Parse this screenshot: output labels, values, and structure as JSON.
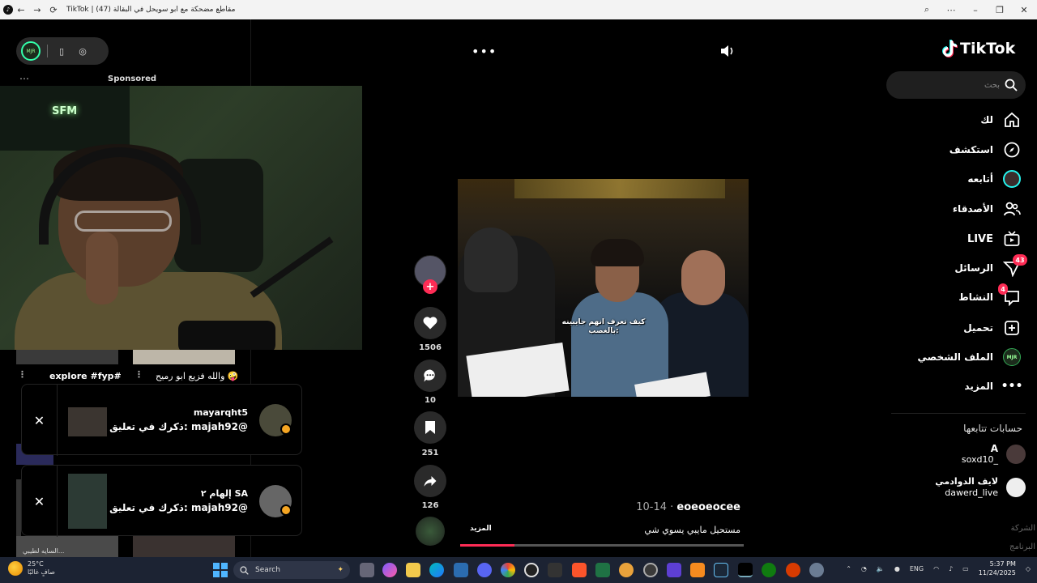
{
  "browser": {
    "tab_title": "TikTok | مقاطع مضحكة مع ابو سويحل في البقالة (47)",
    "back_icon": "arrow-left-icon",
    "reload_icon": "reload-icon",
    "controls": [
      "zoom-icon",
      "more-icon",
      "minimize-icon",
      "restore-icon",
      "close-icon"
    ]
  },
  "left_overlay": {
    "avatar_text": "MJR",
    "sponsored_label": "Sponsored",
    "webcam_logo": "SFM",
    "explore_items": [
      {
        "label": "explore #fyp#"
      },
      {
        "label": "والله فزيع ابو رميح 🤪"
      }
    ],
    "notifications": [
      {
        "name": "mayarqht5",
        "message": "ذكرك في تعليق: majah92@"
      },
      {
        "name": "إلهام ۲ SA",
        "message": "ذكرك في تعليق: majah92@"
      }
    ],
    "bottom_thumb_text": "السايه لطيبي..."
  },
  "video": {
    "caption_line1": "كيف تعرف انهم جايبينه",
    "caption_line2": "بالغصب:",
    "username": "eoeoeocee",
    "date": "10-14",
    "separator": " · ",
    "description": "مستحيل مايبي يسوي شي",
    "more_label": "المزيد",
    "progress_percent": 19
  },
  "actions": {
    "likes": "1506",
    "comments": "10",
    "saves": "251",
    "shares": "126",
    "follow_plus": "+"
  },
  "nav": {
    "logo_text": "TikTok",
    "search_placeholder": "بحث",
    "items": [
      {
        "label": "لك",
        "icon": "home-icon"
      },
      {
        "label": "استكشف",
        "icon": "compass-icon"
      },
      {
        "label": "أتابعه",
        "icon": "following-avatar-icon"
      },
      {
        "label": "الأصدقاء",
        "icon": "friends-icon"
      },
      {
        "label": "LIVE",
        "icon": "live-icon"
      },
      {
        "label": "الرسائل",
        "icon": "messages-icon",
        "badge": "43"
      },
      {
        "label": "النشاط",
        "icon": "activity-icon",
        "badge": "4"
      },
      {
        "label": "تحميل",
        "icon": "upload-icon"
      },
      {
        "label": "الملف الشخصي",
        "icon": "profile-avatar-icon"
      },
      {
        "label": "المزيد",
        "icon": "more-icon"
      }
    ],
    "following_title": "حسابات تتابعها",
    "following_accounts": [
      {
        "display": "A",
        "handle": "soxd10_"
      },
      {
        "display": "لايف الدوادمي",
        "handle": "dawerd_live"
      }
    ],
    "footer_links": [
      "الشركة",
      "البرنامج"
    ]
  },
  "taskbar": {
    "temperature": "25°C",
    "weather_desc": "صافٍ غالبًا",
    "search_label": "Search",
    "language": "ENG",
    "time": "5:37 PM",
    "date": "11/24/2025"
  },
  "colors": {
    "accent": "#fe2c55",
    "background": "#000000",
    "taskbar": "#1c2333"
  }
}
